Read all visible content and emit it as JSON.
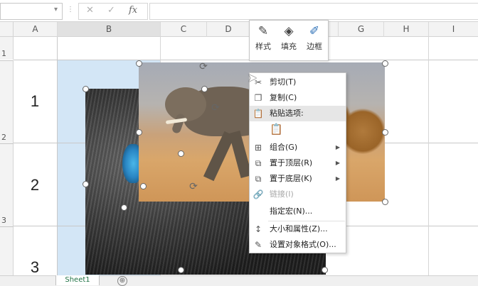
{
  "formula_bar": {
    "cancel": "✕",
    "enter": "✓",
    "fx": "fx",
    "separator": "⋮",
    "dropdown": "▾"
  },
  "columns": [
    "A",
    "B",
    "C",
    "D",
    "E",
    "F",
    "G",
    "H",
    "I"
  ],
  "rows": [
    "1",
    "2",
    "3"
  ],
  "cells": {
    "a1": "1",
    "a2": "2",
    "a3": "3"
  },
  "mini_toolbar": {
    "style": "样式",
    "fill": "填充",
    "border": "边框"
  },
  "context_menu": {
    "items": [
      {
        "label": "剪切(T)",
        "icon": "scissors-icon",
        "enabled": true
      },
      {
        "label": "复制(C)",
        "icon": "copy-icon",
        "enabled": true
      },
      {
        "label": "粘贴选项:",
        "icon": "paste-icon",
        "enabled": true,
        "highlighted": true
      },
      {
        "label": "组合(G)",
        "icon": "group-icon",
        "enabled": true,
        "submenu": true
      },
      {
        "label": "置于顶层(R)",
        "icon": "bring-to-front-icon",
        "enabled": true,
        "submenu": true
      },
      {
        "label": "置于底层(K)",
        "icon": "send-to-back-icon",
        "enabled": true,
        "submenu": true
      },
      {
        "label": "链接(I)",
        "icon": "link-icon",
        "enabled": false
      },
      {
        "label": "指定宏(N)...",
        "icon": "",
        "enabled": true
      },
      {
        "label": "大小和属性(Z)...",
        "icon": "size-icon",
        "enabled": true
      },
      {
        "label": "设置对象格式(O)...",
        "icon": "format-object-icon",
        "enabled": true
      }
    ]
  },
  "sheet_tab": "Sheet1",
  "add_sheet": "⊕",
  "colors": {
    "selected_column": "#d3e6f6",
    "accent": "#217346"
  }
}
